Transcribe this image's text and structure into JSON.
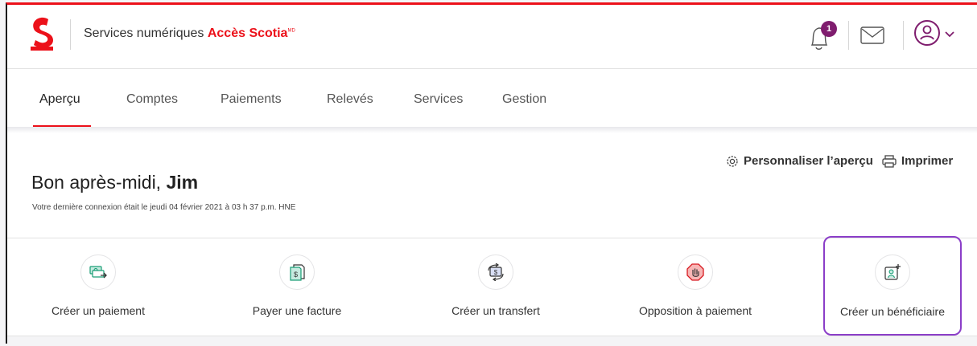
{
  "header": {
    "brand_prefix": "Services numériques ",
    "brand_strong": "Accès Scotia",
    "brand_mark": "MD",
    "notification_count": "1",
    "icons": {
      "logo": "scotiabank-logo",
      "bell": "bell-icon",
      "mail": "mail-icon",
      "user": "user-icon",
      "chevron": "chevron-down-icon"
    }
  },
  "nav": {
    "tabs": [
      {
        "label": "Aperçu"
      },
      {
        "label": "Comptes"
      },
      {
        "label": "Paiements"
      },
      {
        "label": "Relevés"
      },
      {
        "label": "Services"
      },
      {
        "label": "Gestion"
      }
    ],
    "active_tab": "Aperçu"
  },
  "greeting": {
    "prefix": "Bon après-midi, ",
    "name": "Jim",
    "last_login": "Votre dernière connexion était le jeudi 04 février 2021 à 03 h 37 p.m. HNE"
  },
  "tools": {
    "personalize": "Personnaliser l’aperçu",
    "print": "Imprimer"
  },
  "quick_actions": [
    {
      "label": "Créer un paiement",
      "icon": "payment-icon"
    },
    {
      "label": "Payer une facture",
      "icon": "bill-icon"
    },
    {
      "label": "Créer un transfert",
      "icon": "transfer-icon"
    },
    {
      "label": "Opposition à paiement",
      "icon": "stop-payment-icon"
    },
    {
      "label": "Créer un bénéficiaire",
      "icon": "add-payee-icon"
    }
  ],
  "colors": {
    "brand_red": "#ec111a",
    "badge": "#7f1d6e",
    "highlight": "#8b3ec8",
    "icon_green": "#1a9e76"
  }
}
